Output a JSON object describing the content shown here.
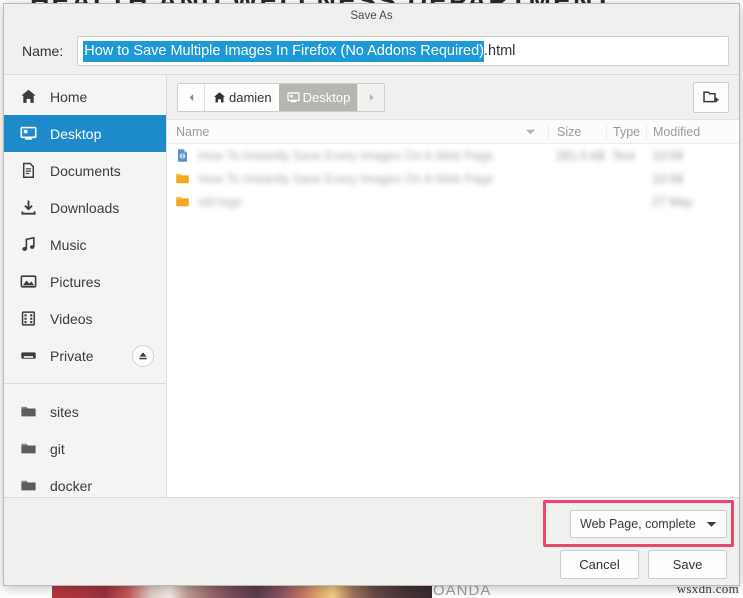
{
  "background": {
    "headline": "HEALTH AND WELLNESS DEPARTMENT",
    "caption": "OANDA",
    "watermark": "wsxdn.com"
  },
  "dialog": {
    "title": "Save As",
    "name_label": "Name:",
    "filename_selected": "How to Save Multiple Images In Firefox (No Addons Required)",
    "filename_extension": ".html"
  },
  "sidebar": {
    "places": [
      {
        "label": "Home",
        "icon": "home-icon",
        "selected": false
      },
      {
        "label": "Desktop",
        "icon": "desktop-icon",
        "selected": true
      },
      {
        "label": "Documents",
        "icon": "document-icon",
        "selected": false
      },
      {
        "label": "Downloads",
        "icon": "download-icon",
        "selected": false
      },
      {
        "label": "Music",
        "icon": "music-note-icon",
        "selected": false
      },
      {
        "label": "Pictures",
        "icon": "image-icon",
        "selected": false
      },
      {
        "label": "Videos",
        "icon": "film-icon",
        "selected": false
      },
      {
        "label": "Private",
        "icon": "drive-icon",
        "selected": false,
        "eject": true
      }
    ],
    "bookmarks": [
      {
        "label": "sites",
        "icon": "folder-icon"
      },
      {
        "label": "git",
        "icon": "folder-icon"
      },
      {
        "label": "docker",
        "icon": "folder-icon"
      }
    ]
  },
  "pathbar": {
    "back_icon": "chevron-left-icon",
    "forward_icon": "chevron-right-icon",
    "crumbs": [
      {
        "label": "damien",
        "icon": "home-icon",
        "active": false
      },
      {
        "label": "Desktop",
        "icon": "desktop-icon",
        "active": true
      }
    ],
    "new_folder_icon": "new-folder-icon"
  },
  "file_list": {
    "columns": [
      "Name",
      "Size",
      "Type",
      "Modified"
    ],
    "sort_icon": "sort-descending-icon",
    "rows": [
      {
        "icon": "html-file-icon",
        "name": "How To Instantly Save Every Images On A Web Page",
        "size": "281.5 kB",
        "type": "Text",
        "modified": "10:08"
      },
      {
        "icon": "folder-icon",
        "name": "How To Instantly Save Every Images On A Web Page",
        "size": "",
        "type": "",
        "modified": "10:08"
      },
      {
        "icon": "folder-icon",
        "name": "old-logs",
        "size": "",
        "type": "",
        "modified": "27 May"
      }
    ]
  },
  "actions": {
    "file_type": "Web Page, complete",
    "file_type_caret": "chevron-down-icon",
    "cancel_label": "Cancel",
    "save_label": "Save"
  },
  "colors": {
    "accent_blue": "#1d8bc9",
    "selection_blue": "#1d99d6",
    "annotation_red": "#e8486b",
    "dialog_bg": "#f0f0ee"
  }
}
